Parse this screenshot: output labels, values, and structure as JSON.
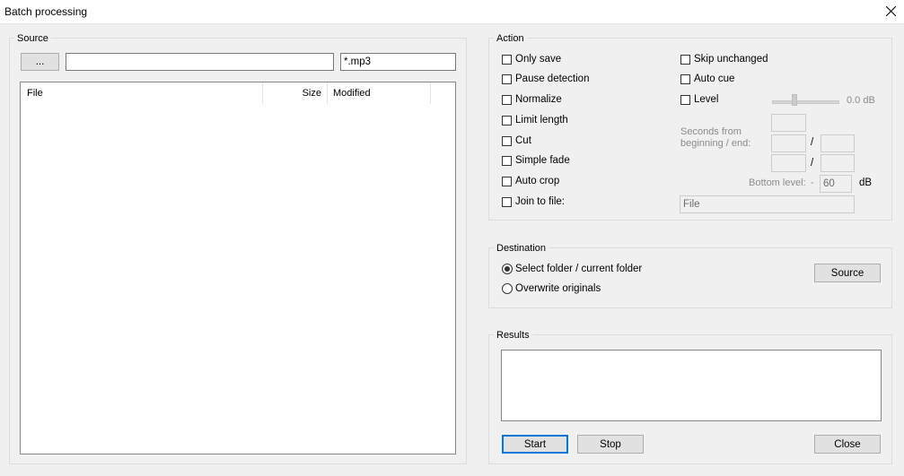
{
  "window": {
    "title": "Batch processing"
  },
  "source": {
    "label": "Source",
    "browse_label": "...",
    "path_value": "",
    "filter_value": "*.mp3",
    "columns": [
      "File",
      "Size",
      "Modified"
    ]
  },
  "action": {
    "label": "Action",
    "only_save": "Only save",
    "pause_detection": "Pause detection",
    "normalize": "Normalize",
    "limit_length": "Limit length",
    "cut": "Cut",
    "simple_fade": "Simple fade",
    "auto_crop": "Auto crop",
    "join_to_file": "Join to file:",
    "skip_unchanged": "Skip unchanged",
    "auto_cue": "Auto cue",
    "level": "Level",
    "level_value": "0.0 dB",
    "seconds_label_1": "Seconds from",
    "seconds_label_2": "beginning / end:",
    "slash": "/",
    "bottom_level_label": "Bottom level:",
    "bottom_level_sign": "-",
    "bottom_level_value": "60",
    "bottom_level_unit": "dB",
    "join_file_value": "File"
  },
  "destination": {
    "label": "Destination",
    "select_folder": "Select folder / current folder",
    "overwrite": "Overwrite originals",
    "source_button": "Source"
  },
  "results": {
    "label": "Results",
    "start": "Start",
    "stop": "Stop",
    "close": "Close"
  }
}
